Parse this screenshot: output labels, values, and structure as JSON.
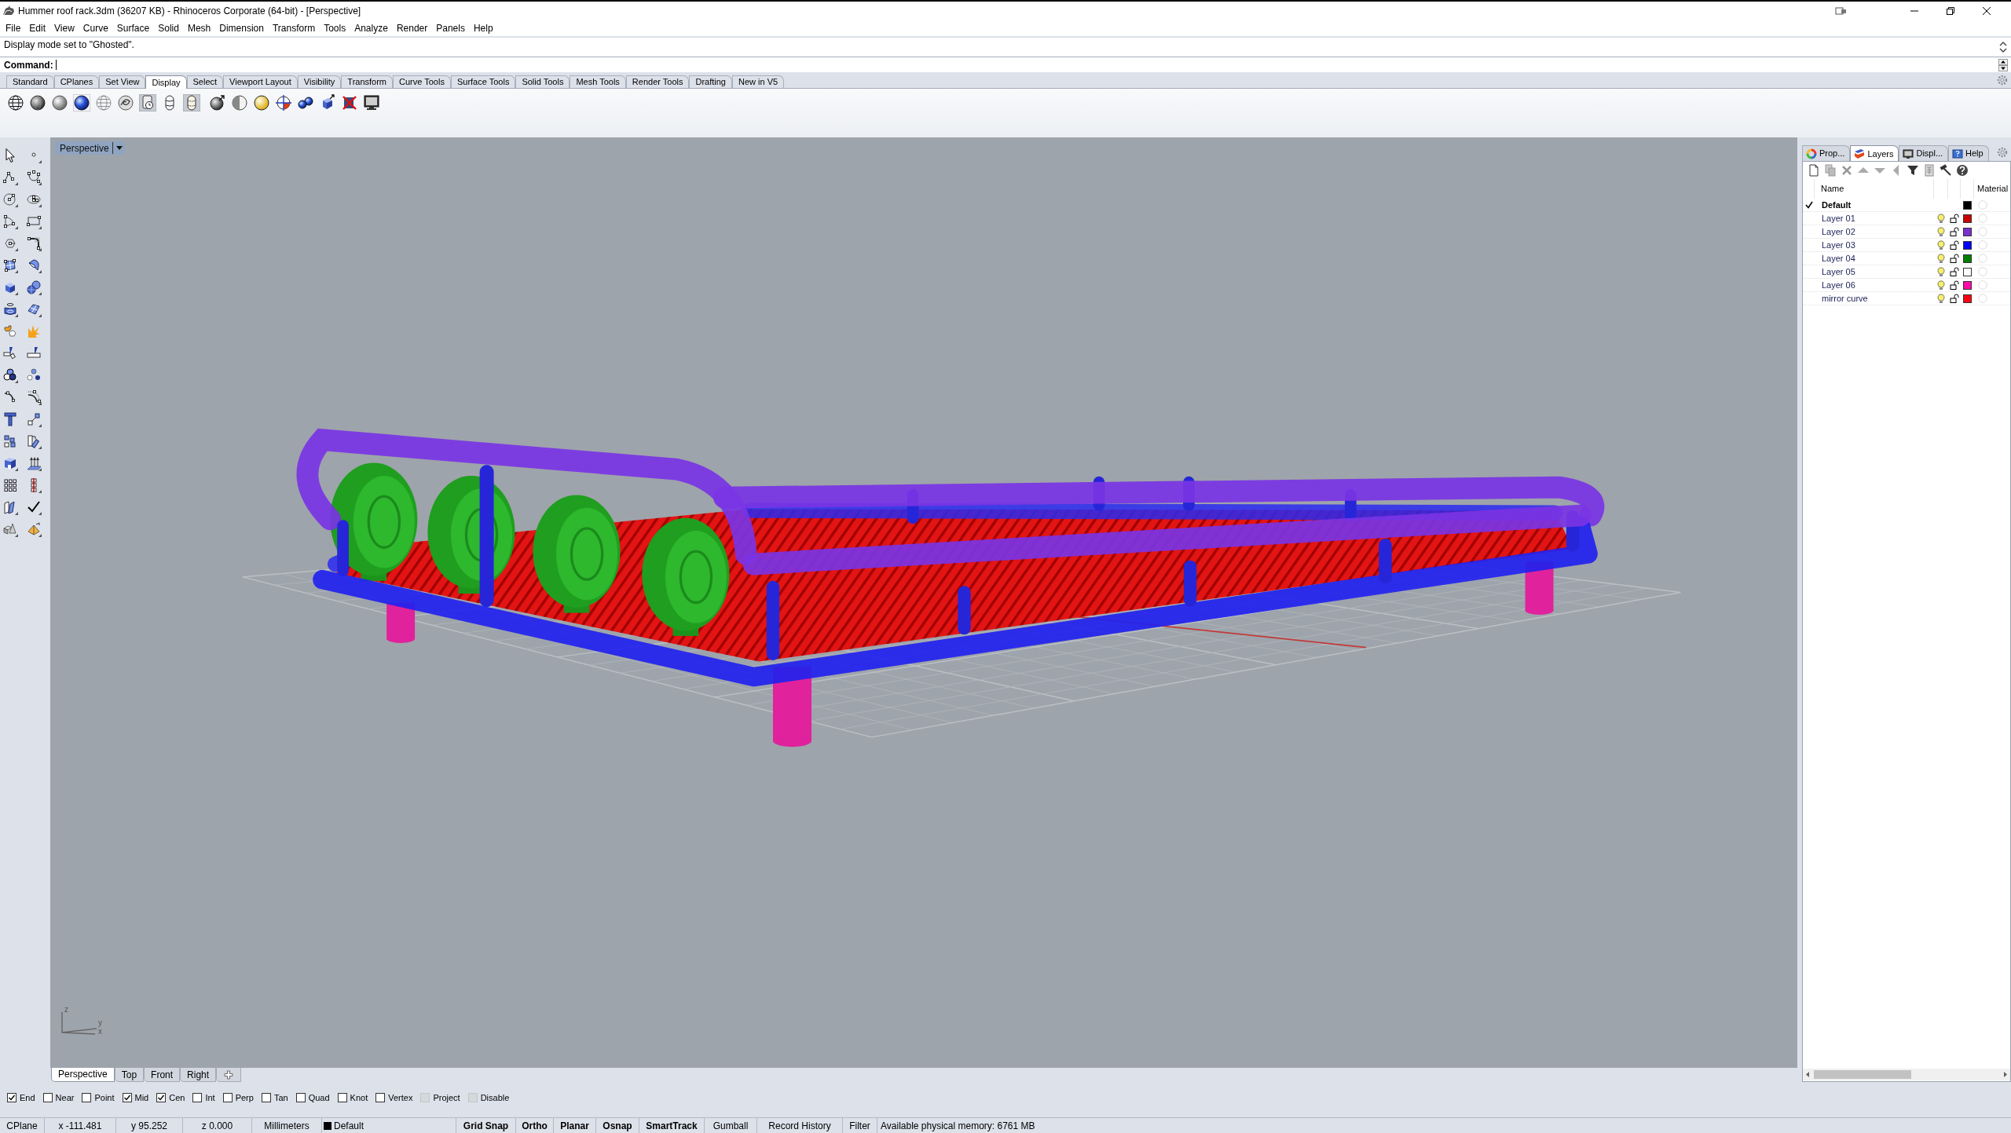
{
  "window": {
    "title": "Hummer roof rack.3dm (36207 KB) - Rhinoceros Corporate (64-bit) - [Perspective]"
  },
  "menu": [
    "File",
    "Edit",
    "View",
    "Curve",
    "Surface",
    "Solid",
    "Mesh",
    "Dimension",
    "Transform",
    "Tools",
    "Analyze",
    "Render",
    "Panels",
    "Help"
  ],
  "command_history": [
    "Display mode set to \"Ghosted\"."
  ],
  "command_line": {
    "prompt": "Command:"
  },
  "toolbar_tabs": [
    {
      "label": "Standard",
      "selected": false
    },
    {
      "label": "CPlanes",
      "selected": false
    },
    {
      "label": "Set View",
      "selected": false
    },
    {
      "label": "Display",
      "selected": true
    },
    {
      "label": "Select",
      "selected": false
    },
    {
      "label": "Viewport Layout",
      "selected": false
    },
    {
      "label": "Visibility",
      "selected": false
    },
    {
      "label": "Transform",
      "selected": false
    },
    {
      "label": "Curve Tools",
      "selected": false
    },
    {
      "label": "Surface Tools",
      "selected": false
    },
    {
      "label": "Solid Tools",
      "selected": false
    },
    {
      "label": "Mesh Tools",
      "selected": false
    },
    {
      "label": "Render Tools",
      "selected": false
    },
    {
      "label": "Drafting",
      "selected": false
    },
    {
      "label": "New in V5",
      "selected": false
    }
  ],
  "display_toolbar": [
    {
      "pressed": false
    },
    {
      "pressed": false
    },
    {
      "pressed": false
    },
    {
      "pressed": false
    },
    {
      "pressed": false
    },
    {
      "pressed": false
    },
    {
      "pressed": true
    },
    {
      "pressed": false
    },
    {
      "pressed": true
    },
    {
      "pressed": false
    },
    {
      "pressed": false
    },
    {
      "pressed": false
    },
    {
      "pressed": false
    },
    {
      "pressed": false
    },
    {
      "pressed": false
    },
    {
      "pressed": false
    },
    {
      "pressed": false
    }
  ],
  "viewport": {
    "title": "Perspective",
    "axis_labels": [
      "z",
      "y",
      "x"
    ]
  },
  "viewport_tabs": [
    {
      "label": "Perspective",
      "selected": true
    },
    {
      "label": "Top",
      "selected": false
    },
    {
      "label": "Front",
      "selected": false
    },
    {
      "label": "Right",
      "selected": false
    }
  ],
  "layers_panel": {
    "tabs": [
      {
        "label": "Prop...",
        "selected": false
      },
      {
        "label": "Layers",
        "selected": true
      },
      {
        "label": "Displ...",
        "selected": false
      },
      {
        "label": "Help",
        "selected": false
      }
    ],
    "columns": [
      "Name",
      "Material"
    ],
    "layers": [
      {
        "name": "Default",
        "current": true,
        "color": "#000000"
      },
      {
        "name": "Layer 01",
        "current": false,
        "on": true,
        "locked": false,
        "color": "#cc0000"
      },
      {
        "name": "Layer 02",
        "current": false,
        "on": true,
        "locked": false,
        "color": "#7d2fd0"
      },
      {
        "name": "Layer 03",
        "current": false,
        "on": true,
        "locked": false,
        "color": "#0000ff"
      },
      {
        "name": "Layer 04",
        "current": false,
        "on": true,
        "locked": false,
        "color": "#007f00"
      },
      {
        "name": "Layer 05",
        "current": false,
        "on": true,
        "locked": false,
        "color": "#ffffff"
      },
      {
        "name": "Layer 06",
        "current": false,
        "on": true,
        "locked": false,
        "color": "#ff0aa8"
      },
      {
        "name": "mirror curve",
        "current": false,
        "on": true,
        "locked": false,
        "color": "#ff0010"
      }
    ]
  },
  "osnaps": [
    {
      "label": "End",
      "checked": true,
      "disabled": false
    },
    {
      "label": "Near",
      "checked": false,
      "disabled": false
    },
    {
      "label": "Point",
      "checked": false,
      "disabled": false
    },
    {
      "label": "Mid",
      "checked": true,
      "disabled": false
    },
    {
      "label": "Cen",
      "checked": true,
      "disabled": false
    },
    {
      "label": "Int",
      "checked": false,
      "disabled": false
    },
    {
      "label": "Perp",
      "checked": false,
      "disabled": false
    },
    {
      "label": "Tan",
      "checked": false,
      "disabled": false
    },
    {
      "label": "Quad",
      "checked": false,
      "disabled": false
    },
    {
      "label": "Knot",
      "checked": false,
      "disabled": false
    },
    {
      "label": "Vertex",
      "checked": false,
      "disabled": false
    },
    {
      "label": "Project",
      "checked": false,
      "disabled": true
    },
    {
      "label": "Disable",
      "checked": false,
      "disabled": true
    }
  ],
  "status_bar": {
    "cplane": "CPlane",
    "x": "x -111.481",
    "y": "y 95.252",
    "z": "z 0.000",
    "units": "Millimeters",
    "layer": {
      "name": "Default",
      "color": "#000000"
    },
    "toggles": [
      {
        "label": "Grid Snap",
        "on": true
      },
      {
        "label": "Ortho",
        "on": true
      },
      {
        "label": "Planar",
        "on": true
      },
      {
        "label": "Osnap",
        "on": true
      },
      {
        "label": "SmartTrack",
        "on": true
      },
      {
        "label": "Gumball",
        "on": false
      },
      {
        "label": "Record History",
        "on": false
      },
      {
        "label": "Filter",
        "on": false
      }
    ],
    "memory": "Available physical memory: 6761 MB"
  }
}
